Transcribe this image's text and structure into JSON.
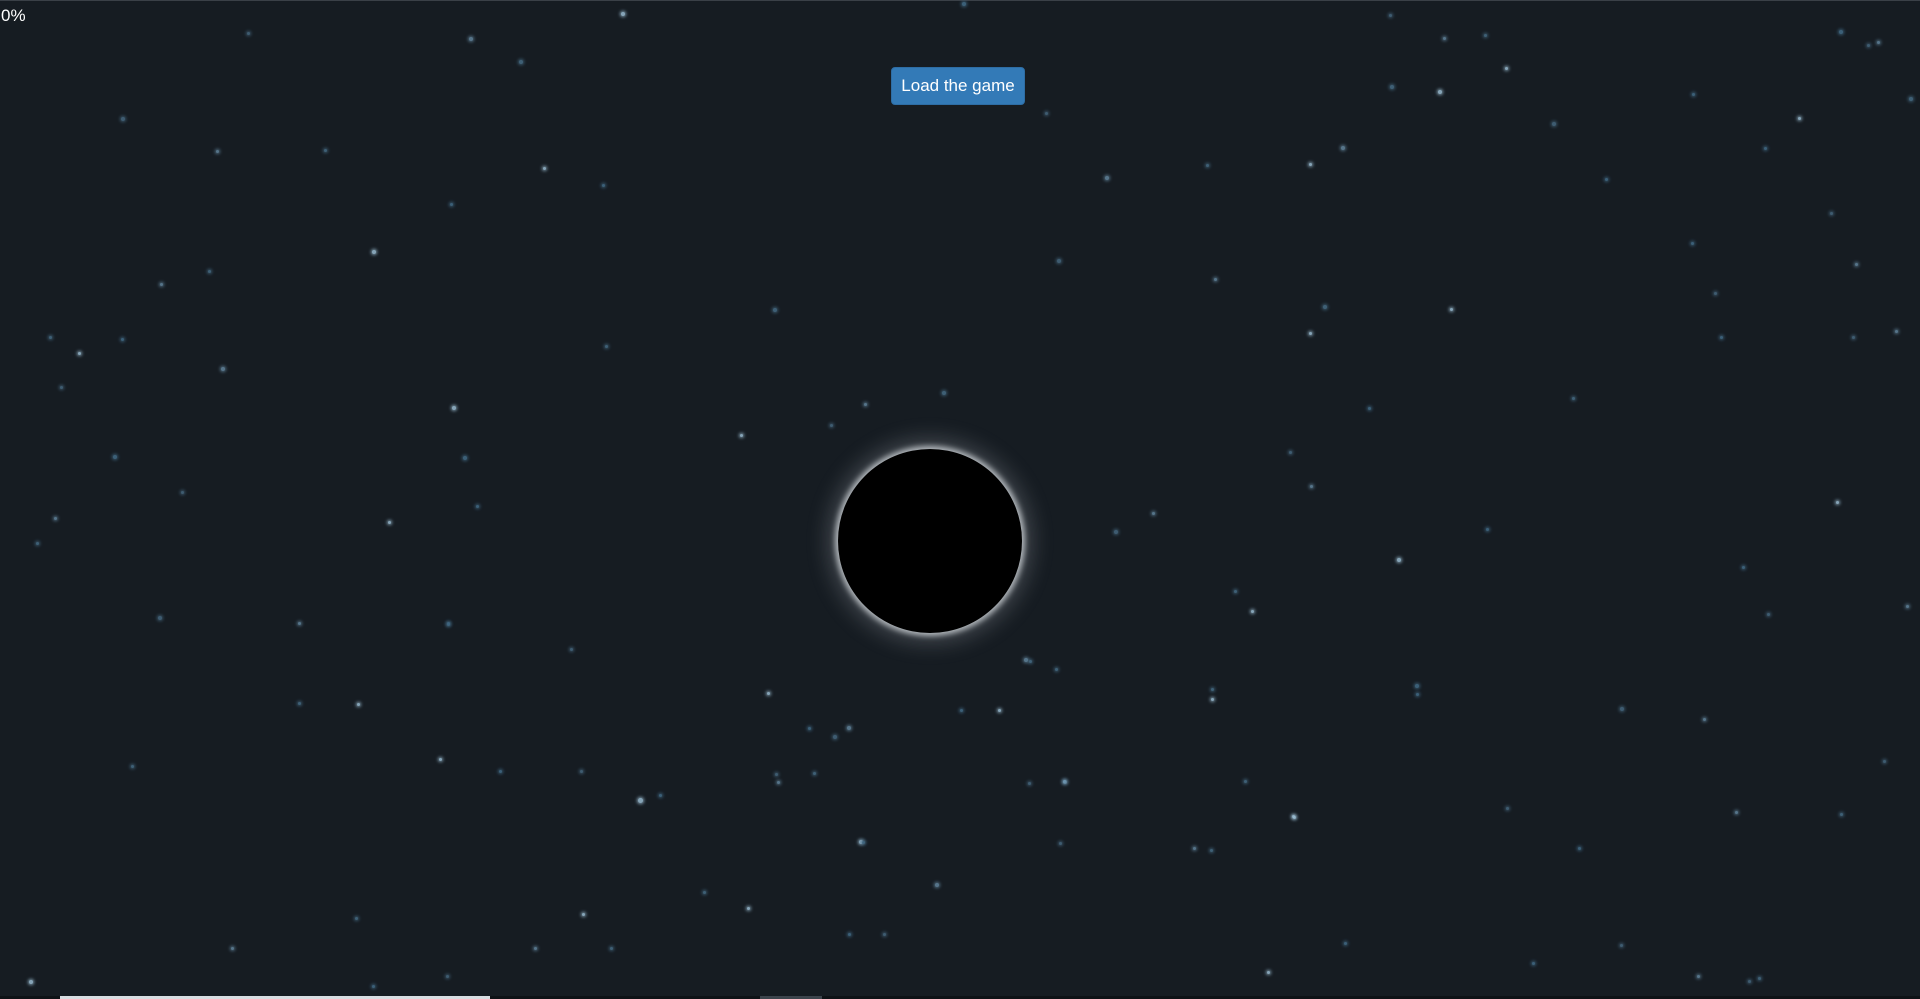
{
  "progress": {
    "percent_label": "0%",
    "value": 0
  },
  "load_button": {
    "label": "Load the game"
  },
  "colors": {
    "background": "#161c22",
    "button": "#337ab7",
    "star_blue": "#5f8fb0",
    "black_hole": "#000000",
    "halo": "#dce1e6"
  },
  "icons": {
    "central_object": "black-hole-icon",
    "stars": "star-icon"
  }
}
